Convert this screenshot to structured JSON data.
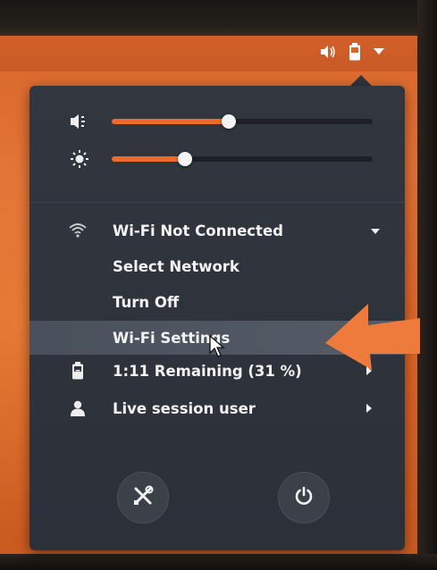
{
  "topbar": {
    "volume_icon": "speaker-icon",
    "battery_icon": "battery-icon",
    "menu_icon": "chevron-down-icon"
  },
  "sliders": {
    "volume": {
      "icon": "volume-icon",
      "level_percent": 45
    },
    "brightness": {
      "icon": "brightness-icon",
      "level_percent": 28
    }
  },
  "wifi": {
    "status": "Wi-Fi Not Connected",
    "icon": "wifi-icon",
    "items": [
      "Select Network",
      "Turn Off",
      "Wi-Fi Settings"
    ]
  },
  "battery": {
    "label": "1:11 Remaining (31 %)",
    "icon": "battery-icon"
  },
  "user": {
    "label": "Live session user",
    "icon": "user-icon"
  },
  "bottom_buttons": {
    "settings_icon": "settings-icon",
    "power_icon": "power-icon"
  },
  "colors": {
    "accent": "#ef6a2a",
    "menu_bg": "#2f343d",
    "highlight": "#505763",
    "desktop": "#e07034",
    "annotation_arrow": "#ee7a3c"
  }
}
